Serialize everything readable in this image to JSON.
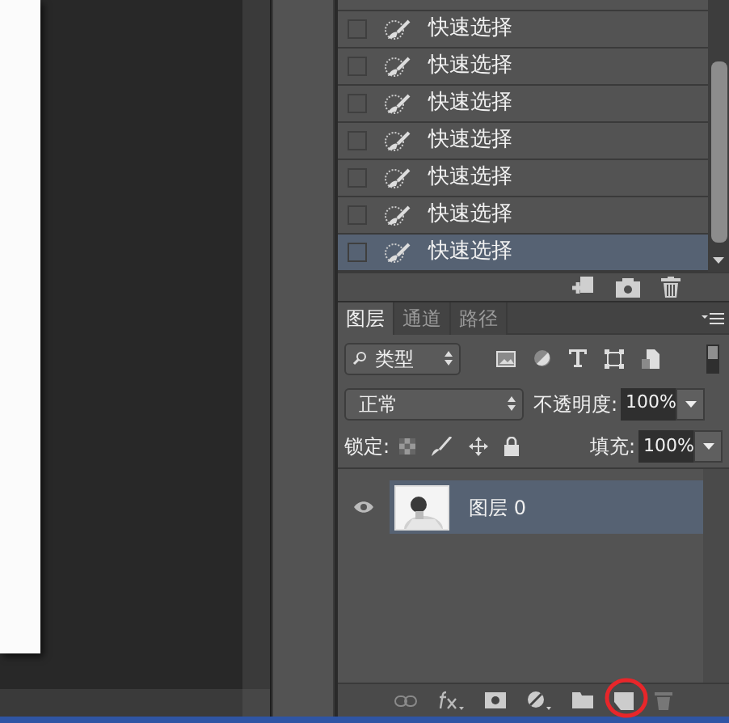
{
  "history": {
    "rows": [
      {
        "label": "快速选择",
        "selected": false
      },
      {
        "label": "快速选择",
        "selected": false
      },
      {
        "label": "快速选择",
        "selected": false
      },
      {
        "label": "快速选择",
        "selected": false
      },
      {
        "label": "快速选择",
        "selected": false
      },
      {
        "label": "快速选择",
        "selected": false
      },
      {
        "label": "快速选择",
        "selected": true
      }
    ]
  },
  "layers_panel": {
    "tabs": [
      {
        "label": "图层",
        "selected": true
      },
      {
        "label": "通道",
        "selected": false
      },
      {
        "label": "路径",
        "selected": false
      }
    ],
    "filter": {
      "value": "类型"
    },
    "blend_mode": {
      "value": "正常"
    },
    "opacity": {
      "label": "不透明度:",
      "value": "100%"
    },
    "lock": {
      "label": "锁定:"
    },
    "fill": {
      "label": "填充:",
      "value": "100%"
    },
    "layers": [
      {
        "name": "图层 0",
        "visible": true,
        "selected": true
      }
    ]
  }
}
